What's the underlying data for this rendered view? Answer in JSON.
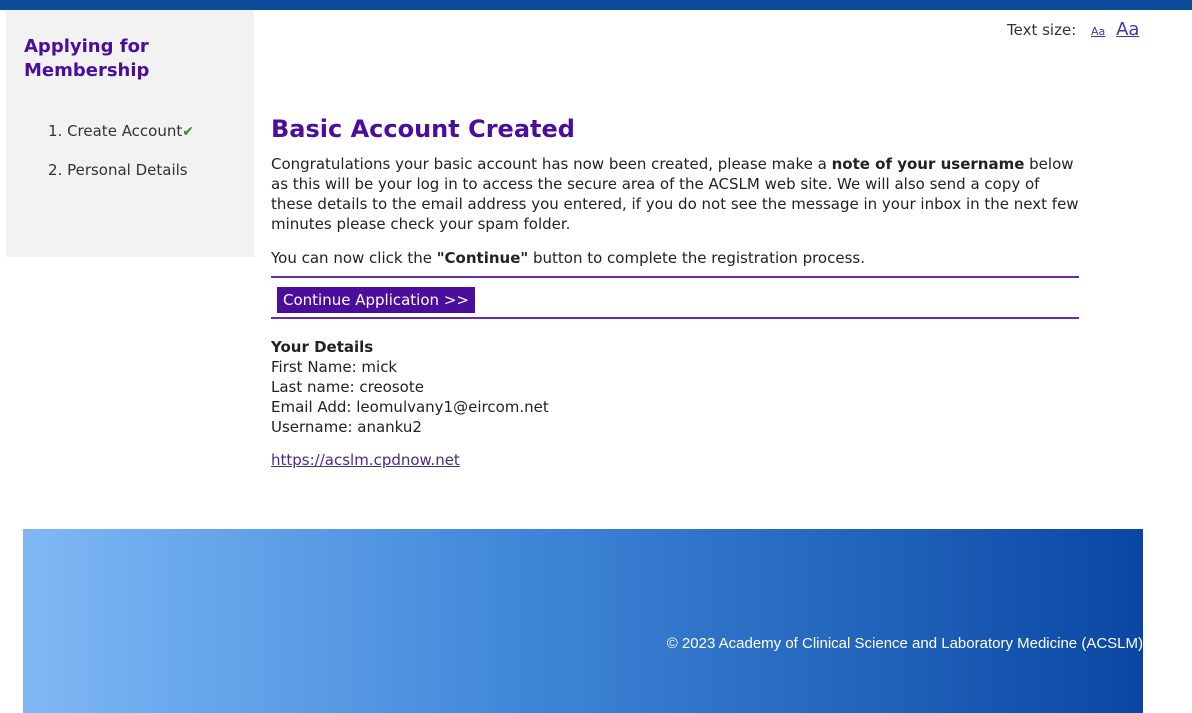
{
  "sidebar": {
    "title": "Applying for Membership",
    "steps": [
      {
        "label": "1. Create Account",
        "check": "✔"
      },
      {
        "label": "2. Personal Details"
      }
    ]
  },
  "text_size": {
    "label": "Text size:",
    "small": "Aa",
    "large": "Aa"
  },
  "main": {
    "title": "Basic Account Created",
    "para1_a": "Congratulations your basic account has now been created, please make a ",
    "para1_bold1": "note of your username",
    "para1_b": " below as this will be your log in to access the secure area of the ACSLM web site.  We will also send a copy of these details to the email address you entered, if you do not see the message in your inbox in the next few minutes please check your spam folder.",
    "para2_a": "You can now click the ",
    "para2_bold": "\"Continue\"",
    "para2_b": " button to complete the registration process.",
    "continue_label": "Continue Application >>"
  },
  "details": {
    "heading": "Your Details",
    "first_name": "First Name: mick",
    "last_name": "Last name: creosote",
    "email": "Email Add: leomulvany1@eircom.net",
    "username": "Username: ananku2",
    "link": "https://acslm.cpdnow.net"
  },
  "footer": {
    "text": "© 2023 Academy of Clinical Science and Laboratory Medicine (ACSLM)"
  },
  "colors": {
    "accent": "#4b0d9c",
    "topbar": "#0c4a9a",
    "check": "#2e8b2e"
  }
}
